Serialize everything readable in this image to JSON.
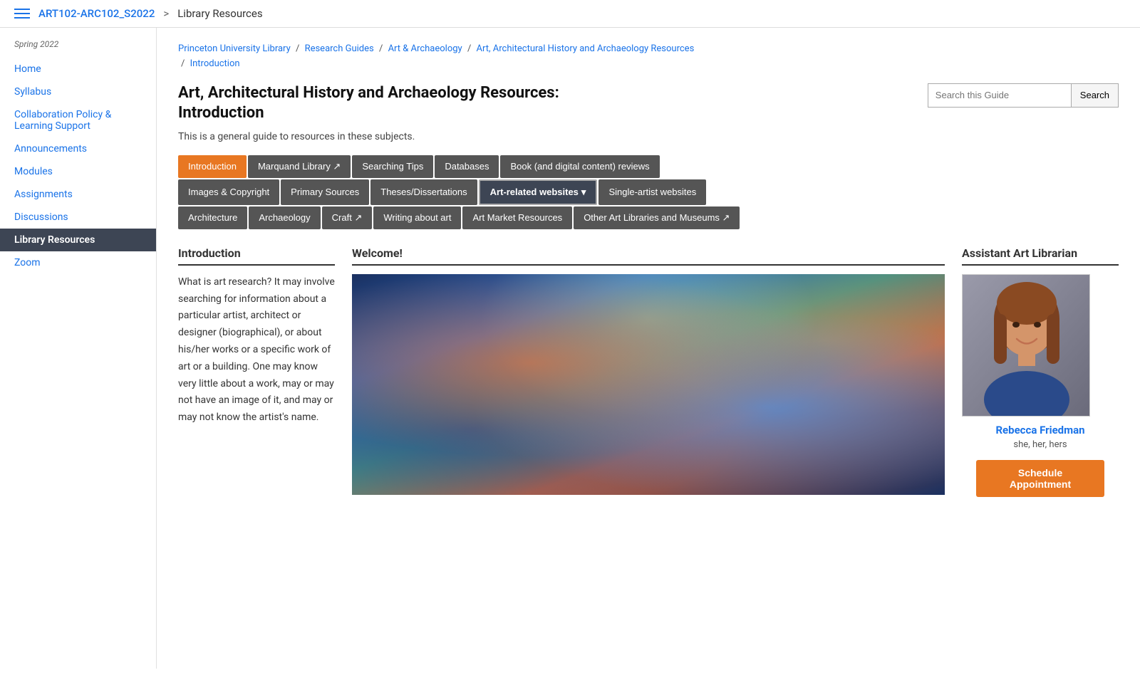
{
  "topNav": {
    "courseCode": "ART102-ARC102_S2022",
    "separator": ">",
    "currentPage": "Library Resources"
  },
  "sidebar": {
    "semester": "Spring 2022",
    "items": [
      {
        "label": "Home",
        "active": false
      },
      {
        "label": "Syllabus",
        "active": false
      },
      {
        "label": "Collaboration Policy & Learning Support",
        "active": false
      },
      {
        "label": "Announcements",
        "active": false
      },
      {
        "label": "Modules",
        "active": false
      },
      {
        "label": "Assignments",
        "active": false
      },
      {
        "label": "Discussions",
        "active": false
      },
      {
        "label": "Library Resources",
        "active": true
      },
      {
        "label": "Zoom",
        "active": false
      }
    ]
  },
  "breadcrumb": {
    "parts": [
      "Princeton University Library",
      "Research Guides",
      "Art & Archaeology",
      "Art, Architectural History and Archaeology Resources",
      "Introduction"
    ]
  },
  "pageTitle": "Art, Architectural History and Archaeology Resources: Introduction",
  "pageSubtitle": "This is a general guide to resources in these subjects.",
  "search": {
    "placeholder": "Search this Guide",
    "buttonLabel": "Search"
  },
  "tabs": {
    "row1": [
      {
        "label": "Introduction",
        "active": true
      },
      {
        "label": "Marquand Library ↗",
        "active": false
      },
      {
        "label": "Searching Tips",
        "active": false
      },
      {
        "label": "Databases",
        "active": false
      },
      {
        "label": "Book (and digital content) reviews",
        "active": false
      }
    ],
    "row2": [
      {
        "label": "Images & Copyright",
        "active": false
      },
      {
        "label": "Primary Sources",
        "active": false
      },
      {
        "label": "Theses/Dissertations",
        "active": false
      },
      {
        "label": "Art-related websites ▾",
        "active": false,
        "highlighted": true
      },
      {
        "label": "Single-artist websites",
        "active": false
      }
    ],
    "row3": [
      {
        "label": "Architecture",
        "active": false
      },
      {
        "label": "Archaeology",
        "active": false
      },
      {
        "label": "Craft ↗",
        "active": false
      },
      {
        "label": "Writing about art",
        "active": false
      },
      {
        "label": "Art Market Resources",
        "active": false
      },
      {
        "label": "Other Art Libraries and Museums ↗",
        "active": false
      }
    ]
  },
  "introSection": {
    "title": "Introduction",
    "body": "What is art research?  It may involve searching for information about a particular artist, architect or designer (biographical), or about his/her works or a specific work of art or a building. One may know very little about a work, may or may not have an image of it, and may or may not know the artist's name."
  },
  "welcomeSection": {
    "title": "Welcome!"
  },
  "assistantSection": {
    "title": "Assistant Art Librarian",
    "name": "Rebecca Friedman",
    "pronouns": "she, her, hers",
    "scheduleLabel": "Schedule Appointment"
  }
}
